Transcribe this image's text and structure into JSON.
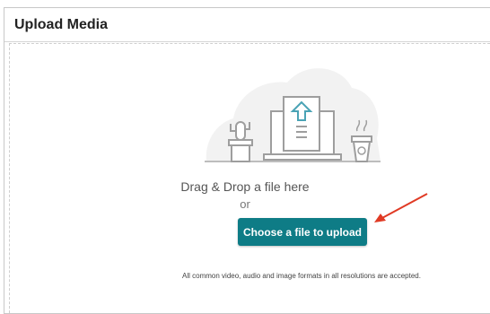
{
  "panel": {
    "title": "Upload Media"
  },
  "dropzone": {
    "drag_text": "Drag & Drop a file here",
    "or_text": "or",
    "button_label": "Choose a file to upload",
    "formats_note": "All common video, audio and image formats in all resolutions are accepted."
  },
  "colors": {
    "button": "#0e7c86",
    "annotation_arrow": "#e03a24"
  },
  "icons": [
    "upload-illustration-icon",
    "annotation-arrow-icon"
  ]
}
